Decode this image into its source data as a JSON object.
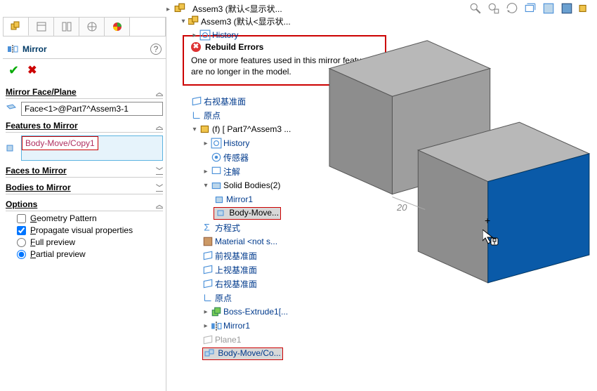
{
  "top": {
    "title": "Assem3   (默认<显示状..."
  },
  "panel": {
    "title": "Mirror",
    "section_face": "Mirror Face/Plane",
    "face_value": "Face<1>@Part7^Assem3-1",
    "section_features": "Features to Mirror",
    "feature_item": "Body-Move/Copy1",
    "section_faces": "Faces to Mirror",
    "section_bodies": "Bodies to Mirror",
    "section_options": "Options",
    "opt_geom": "eometry Pattern",
    "opt_prop": "ropagate visual properties",
    "opt_full": "ull preview",
    "opt_partial": "artial preview"
  },
  "popup": {
    "title": "Rebuild Errors",
    "body": "One or more features used in this mirror feature are no longer in the model."
  },
  "tree": {
    "root": "Assem3   (默认<显示状...",
    "history": "History",
    "r_face": "右视基准面",
    "origin": "原点",
    "part": "(f) [ Part7^Assem3 ...",
    "p_hist": "History",
    "p_sens": "传感器",
    "p_anno": "注解",
    "p_solid": "Solid Bodies(2)",
    "p_mirror1": "Mirror1",
    "p_body": "Body-Move...",
    "p_eqn": "方程式",
    "p_mat": "Material <not s...",
    "p_front": "前视基准面",
    "p_top": "上视基准面",
    "p_right": "右视基准面",
    "p_origin": "原点",
    "p_boss": "Boss-Extrude1[...",
    "p_mirror1b": "Mirror1",
    "p_plane1": "Plane1",
    "p_bodycopy": "Body-Move/Co..."
  },
  "dim": "20"
}
